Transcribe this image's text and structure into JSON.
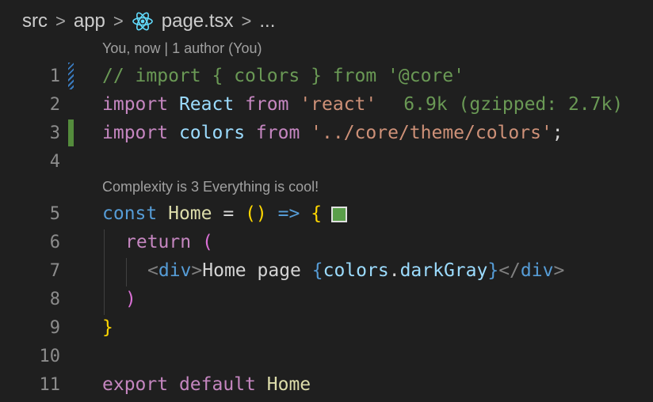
{
  "breadcrumb": {
    "items": [
      "src",
      "app",
      "page.tsx",
      "..."
    ],
    "separator": ">"
  },
  "codelens": {
    "blame": "You, now | 1 author (You)",
    "complexity": "Complexity is 3 Everything is cool!"
  },
  "lines": [
    {
      "number": "1",
      "tokens": [
        "// import { colors } from '@core'"
      ]
    },
    {
      "number": "2",
      "tokens": [
        "import",
        "React",
        "from",
        "'react'"
      ],
      "import_cost": "6.9k (gzipped: 2.7k)"
    },
    {
      "number": "3",
      "tokens": [
        "import",
        "colors",
        "from",
        "'../core/theme/colors'",
        ";"
      ]
    },
    {
      "number": "4",
      "tokens": []
    },
    {
      "number": "5",
      "tokens": [
        "const",
        "Home",
        "=",
        "()",
        "=>",
        "{"
      ],
      "swatch_color": "#5a9e4a"
    },
    {
      "number": "6",
      "tokens": [
        "return",
        "("
      ]
    },
    {
      "number": "7",
      "tokens": [
        "<",
        "div",
        ">",
        "Home page ",
        "{",
        "colors",
        ".",
        "darkGray",
        "}",
        "</",
        "div",
        ">"
      ]
    },
    {
      "number": "8",
      "tokens": [
        ")"
      ]
    },
    {
      "number": "9",
      "tokens": [
        "}"
      ]
    },
    {
      "number": "10",
      "tokens": []
    },
    {
      "number": "11",
      "tokens": [
        "export",
        "default",
        "Home"
      ]
    }
  ],
  "colors": {
    "background": "#1f1f1f",
    "gutter_modified": "#3a7bbf",
    "gutter_added": "#548c3c"
  }
}
